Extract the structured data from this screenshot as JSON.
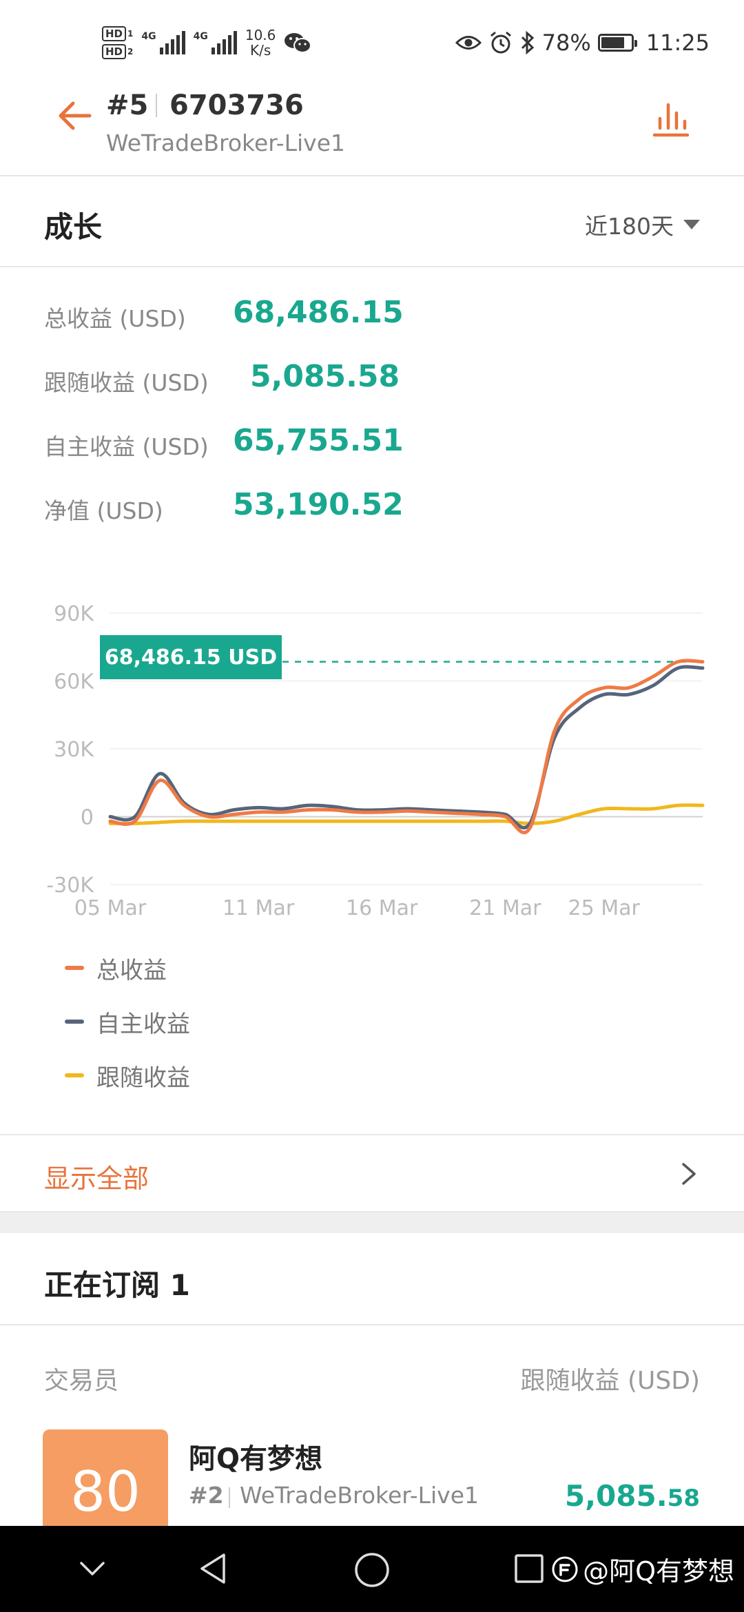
{
  "status_bar": {
    "hd1": "HD",
    "hd1_sub": "1",
    "hd2": "HD",
    "hd2_sub": "2",
    "net1": "4G",
    "net2": "4G",
    "speed_value": "10.6",
    "speed_unit": "K/s",
    "battery": "78%",
    "battery_level": 0.78,
    "time": "11:25"
  },
  "header": {
    "rank": "#5",
    "account": "6703736",
    "broker": "WeTradeBroker-Live1"
  },
  "growth": {
    "title": "成长",
    "period": "近180天",
    "stats": [
      {
        "label": "总收益 (USD)",
        "value": "68,486.15"
      },
      {
        "label": "跟随收益 (USD)",
        "value": "5,085.58"
      },
      {
        "label": "自主收益 (USD)",
        "value": "65,755.51"
      },
      {
        "label": "净值 (USD)",
        "value": "53,190.52"
      }
    ]
  },
  "chart_data": {
    "type": "line",
    "y_ticks": [
      "90K",
      "60K",
      "30K",
      "0",
      "-30K"
    ],
    "x_ticks": [
      "05 Mar",
      "11 Mar",
      "16 Mar",
      "21 Mar",
      "25 Mar"
    ],
    "ylim": [
      -30000,
      90000
    ],
    "tooltip": "68,486.15 USD",
    "reference_value": 68486.15,
    "x": [
      "05 Mar",
      "06 Mar",
      "07 Mar",
      "08 Mar",
      "09 Mar",
      "10 Mar",
      "11 Mar",
      "12 Mar",
      "13 Mar",
      "14 Mar",
      "15 Mar",
      "16 Mar",
      "17 Mar",
      "18 Mar",
      "19 Mar",
      "20 Mar",
      "21 Mar",
      "22 Mar",
      "23 Mar",
      "24 Mar",
      "25 Mar",
      "26 Mar",
      "27 Mar",
      "28 Mar",
      "29 Mar"
    ],
    "series": [
      {
        "name": "总收益",
        "color": "#ef7a45",
        "values": [
          -2000,
          -2000,
          16000,
          5000,
          0,
          1000,
          2000,
          2000,
          3000,
          3000,
          2000,
          2000,
          2500,
          2000,
          1500,
          1000,
          0,
          -5000,
          38000,
          52000,
          57000,
          57000,
          62000,
          68500,
          68500
        ]
      },
      {
        "name": "自主收益",
        "color": "#56657a",
        "values": [
          0,
          0,
          19000,
          6000,
          1000,
          3000,
          4000,
          3500,
          5000,
          4500,
          3000,
          3000,
          3500,
          3000,
          2500,
          2000,
          1000,
          -3000,
          35000,
          48000,
          54000,
          54000,
          58000,
          65700,
          65700
        ]
      },
      {
        "name": "跟随收益",
        "color": "#f1b71c",
        "values": [
          -3000,
          -3000,
          -2500,
          -2000,
          -2000,
          -2000,
          -2000,
          -2000,
          -2000,
          -2000,
          -2000,
          -2000,
          -2000,
          -2000,
          -2000,
          -2000,
          -2000,
          -3000,
          -2000,
          1000,
          3500,
          3500,
          3500,
          5000,
          5000
        ]
      }
    ]
  },
  "legend": [
    "总收益",
    "自主收益",
    "跟随收益"
  ],
  "show_all": "显示全部",
  "subscription": {
    "title": "正在订阅 1",
    "col_trader": "交易员",
    "col_follow": "跟随收益 (USD)",
    "trader": {
      "score": "80",
      "name": "阿Q有梦想",
      "rank": "#2",
      "broker": "WeTradeBroker-Live1",
      "profit_int": "5,085.",
      "profit_dec": "58"
    }
  },
  "watermark": "@阿Q有梦想"
}
